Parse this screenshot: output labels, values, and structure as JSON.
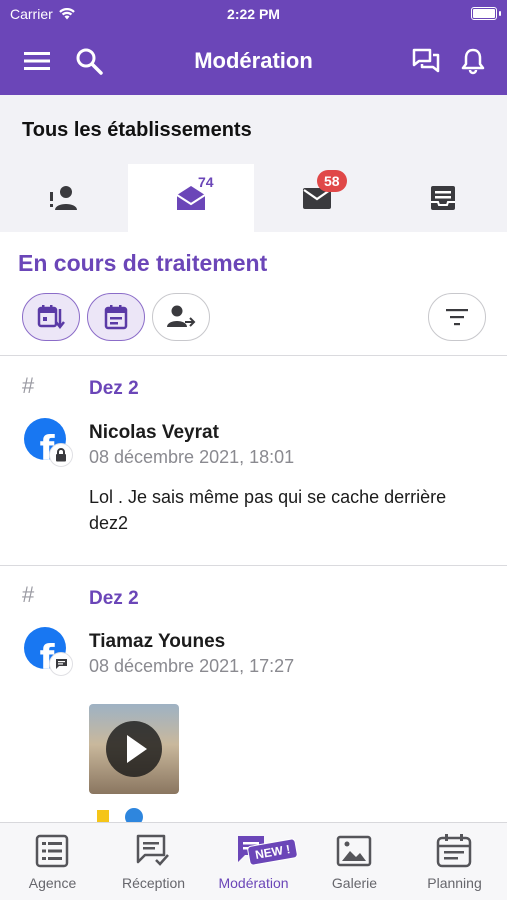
{
  "status_bar": {
    "carrier": "Carrier",
    "time": "2:22 PM"
  },
  "nav": {
    "title": "Modération"
  },
  "establishment": {
    "title": "Tous les établissements"
  },
  "tabs": [
    {
      "icon": "person-alert-icon",
      "badge": ""
    },
    {
      "icon": "mail-open-icon",
      "badge": "74"
    },
    {
      "icon": "mail-icon",
      "badge": "58"
    },
    {
      "icon": "archive-icon",
      "badge": ""
    }
  ],
  "section": {
    "title": "En cours de traitement"
  },
  "posts": [
    {
      "hash": "#",
      "source": "Dez 2",
      "author": "Nicolas Veyrat",
      "date": "08 décembre 2021, 18:01",
      "text": "Lol . Je sais même pas qui se cache derrière dez2",
      "sub_icon": "lock-icon"
    },
    {
      "hash": "#",
      "source": "Dez 2",
      "author": "Tiamaz Younes",
      "date": "08 décembre 2021, 17:27",
      "text": "",
      "sub_icon": "comment-icon"
    }
  ],
  "bottom_tabs": [
    {
      "label": "Agence",
      "icon": "list-icon"
    },
    {
      "label": "Réception",
      "icon": "reception-icon"
    },
    {
      "label": "Modération",
      "icon": "moderation-icon"
    },
    {
      "label": "Galerie",
      "icon": "gallery-icon"
    },
    {
      "label": "Planning",
      "icon": "planning-icon"
    }
  ],
  "new_badge": "NEW !",
  "colors": {
    "accent": "#6b46b8",
    "badge_red": "#e04848",
    "facebook": "#1877f2"
  }
}
